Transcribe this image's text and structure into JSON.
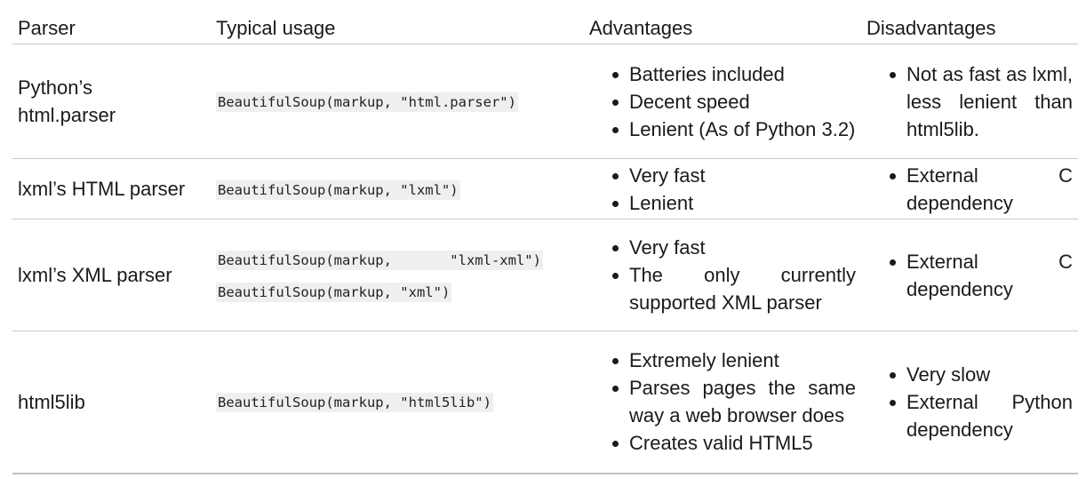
{
  "headers": [
    "Parser",
    "Typical usage",
    "Advantages",
    "Disadvantages"
  ],
  "rows": [
    {
      "parser": "Python’s html.parser",
      "usage": [
        "BeautifulSoup(markup, \"html.parser\")"
      ],
      "advantages": [
        "Batteries included",
        "Decent speed",
        "Lenient (As of Python 3.2)"
      ],
      "disadvantages": [
        "Not as fast as lxml, less lenient than html5lib."
      ]
    },
    {
      "parser": "lxml’s HTML parser",
      "usage": [
        "BeautifulSoup(markup, \"lxml\")"
      ],
      "advantages": [
        "Very fast",
        "Lenient"
      ],
      "disadvantages": [
        "External C dependency"
      ]
    },
    {
      "parser": "lxml’s XML parser",
      "usage": [
        "BeautifulSoup(markup,       \"lxml-xml\")",
        "BeautifulSoup(markup, \"xml\")"
      ],
      "advantages": [
        "Very fast",
        "The only currently supported XML parser"
      ],
      "disadvantages": [
        "External C dependency"
      ]
    },
    {
      "parser": "html5lib",
      "usage": [
        "BeautifulSoup(markup, \"html5lib\")"
      ],
      "advantages": [
        "Extremely lenient",
        "Parses pages the same way a web browser does",
        "Creates valid HTML5"
      ],
      "disadvantages": [
        "Very slow",
        "External Python dependency"
      ]
    }
  ]
}
